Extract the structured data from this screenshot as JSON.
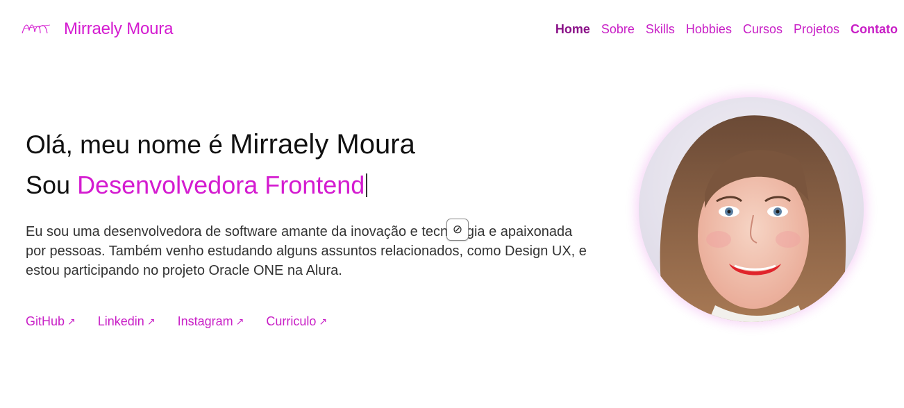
{
  "header": {
    "brand": "Mirraely Moura",
    "nav": [
      {
        "label": "Home"
      },
      {
        "label": "Sobre"
      },
      {
        "label": "Skills"
      },
      {
        "label": "Hobbies"
      },
      {
        "label": "Cursos"
      },
      {
        "label": "Projetos"
      },
      {
        "label": "Contato"
      }
    ]
  },
  "hero": {
    "greeting": "Olá, meu nome é ",
    "name": "Mirraely Moura",
    "role_prefix": "Sou ",
    "role": "Desenvolvedora Frontend",
    "description": "Eu sou uma desenvolvedora de software amante da inovação e tecnologia e apaixonada por pessoas. Também venho estudando alguns assuntos relacionados, como Design UX, e estou participando no projeto Oracle ONE na Alura.",
    "tooltip_symbol": "⊘"
  },
  "links": [
    {
      "label": "GitHub",
      "icon": "arrow-up-right-icon"
    },
    {
      "label": "Linkedin",
      "icon": "arrow-up-right-icon"
    },
    {
      "label": "Instagram",
      "icon": "arrow-up-right-icon"
    },
    {
      "label": "Curriculo",
      "icon": "arrow-up-right-icon"
    }
  ],
  "colors": {
    "accent": "#d41bd0",
    "nav_active": "#8a1288"
  }
}
